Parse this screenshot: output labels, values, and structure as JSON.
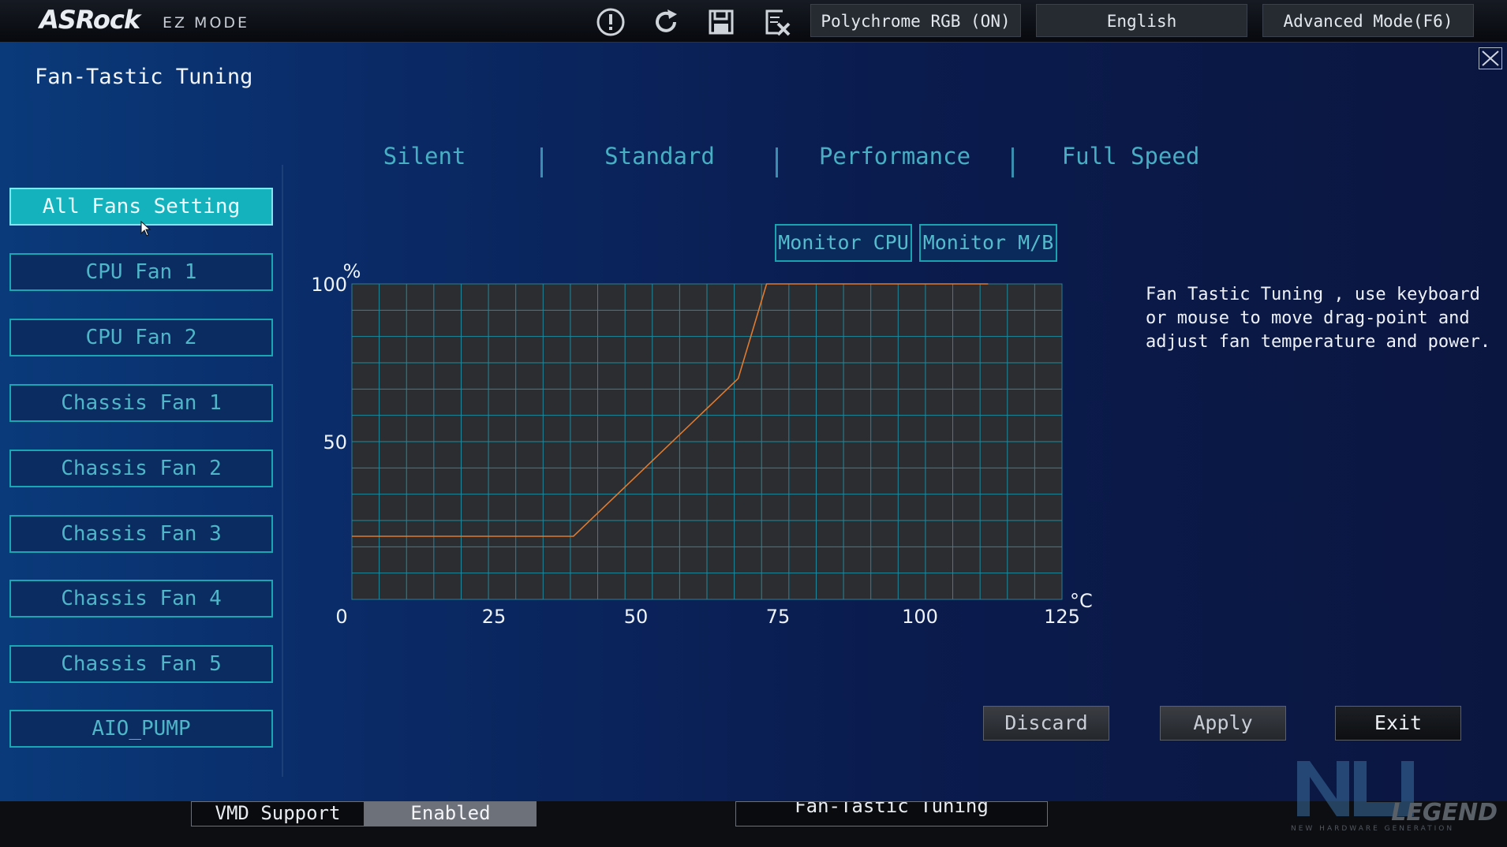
{
  "header": {
    "brand": "ASRock",
    "mode": "EZ MODE",
    "icons": [
      "warning-icon",
      "refresh-icon",
      "save-icon",
      "exit-discard-icon"
    ],
    "polychrome_label": "Polychrome RGB (ON)",
    "language_label": "English",
    "advanced_label": "Advanced Mode(F6)"
  },
  "panel": {
    "title": "Fan-Tastic Tuning"
  },
  "fans": [
    {
      "label": "All Fans Setting",
      "active": true
    },
    {
      "label": "CPU Fan 1"
    },
    {
      "label": "CPU Fan 2"
    },
    {
      "label": "Chassis Fan 1"
    },
    {
      "label": "Chassis Fan 2"
    },
    {
      "label": "Chassis Fan 3"
    },
    {
      "label": "Chassis Fan 4"
    },
    {
      "label": "Chassis Fan 5"
    },
    {
      "label": "AIO_PUMP"
    }
  ],
  "modes": [
    "Silent",
    "Standard",
    "Performance",
    "Full Speed"
  ],
  "monitor": {
    "cpu_label": "Monitor CPU",
    "mb_label": "Monitor M/B"
  },
  "chart_data": {
    "type": "line",
    "xlabel": "°C",
    "ylabel": "%",
    "xlim": [
      0,
      125
    ],
    "ylim": [
      0,
      100
    ],
    "x_ticks": [
      "0",
      "25",
      "50",
      "75",
      "100",
      "125"
    ],
    "y_ticks": [
      "100",
      "50"
    ],
    "y_zero_label": "0",
    "grid": true,
    "series": [
      {
        "color": "#e07a2e",
        "points": [
          [
            0,
            20
          ],
          [
            39,
            20
          ],
          [
            68,
            70
          ],
          [
            73,
            100
          ],
          [
            112,
            100
          ]
        ]
      }
    ]
  },
  "help_text": "Fan Tastic Tuning , use keyboard\nor mouse to move drag-point and\nadjust fan temperature and power.",
  "actions": {
    "discard": "Discard",
    "apply": "Apply",
    "exit": "Exit"
  },
  "bottom_strip": {
    "vmd_label": "VMD Support",
    "vmd_value": "Enabled",
    "fantastic_label": "Fan-Tastic Tuning"
  },
  "watermark": {
    "text": "LEGEND",
    "sub": "NEW HARDWARE GENERATION"
  }
}
